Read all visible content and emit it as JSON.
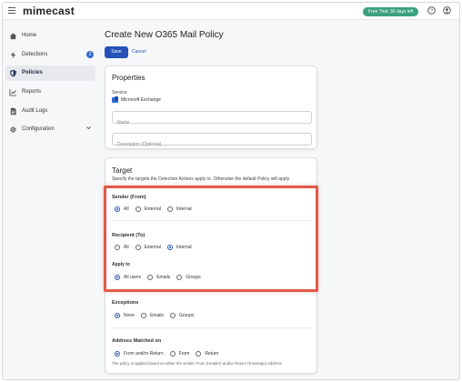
{
  "app": {
    "logo": "mimecast",
    "trial_badge": "Free Trial: 30 days left",
    "help_icon": "help-icon",
    "account_icon": "account-icon"
  },
  "sidebar": {
    "items": [
      {
        "label": "Home",
        "icon": "home-icon"
      },
      {
        "label": "Detections",
        "icon": "bolt-icon",
        "badge": "2"
      },
      {
        "label": "Policies",
        "icon": "shield-icon",
        "active": true
      },
      {
        "label": "Reports",
        "icon": "chart-icon"
      },
      {
        "label": "Audit Logs",
        "icon": "document-icon"
      },
      {
        "label": "Configuration",
        "icon": "gear-icon",
        "expandable": true
      }
    ]
  },
  "page": {
    "title": "Create New O365 Mail Policy",
    "save_label": "Save",
    "cancel_label": "Cancel"
  },
  "properties": {
    "title": "Properties",
    "service_label": "Service",
    "service_value": "Microsoft Exchange",
    "name_placeholder": "Name",
    "description_placeholder": "Description (Optional)"
  },
  "target": {
    "title": "Target",
    "description": "Specify the targets the Detection Actions apply to. Otherwise the default Policy will apply.",
    "sender": {
      "label": "Sender (From)",
      "options": [
        "All",
        "External",
        "Internal"
      ],
      "selected": "All"
    },
    "recipient": {
      "label": "Recipient (To)",
      "options": [
        "All",
        "External",
        "Internal"
      ],
      "selected": "Internal"
    },
    "apply_to": {
      "label": "Apply to",
      "options": [
        "All users",
        "Emails",
        "Groups"
      ],
      "selected": "All users"
    },
    "exceptions": {
      "label": "Exceptions",
      "options": [
        "None",
        "Emails",
        "Groups"
      ],
      "selected": "None"
    },
    "address_matched": {
      "label": "Address Matched on",
      "options": [
        "From and/or Return",
        "From",
        "Return"
      ],
      "selected": "From and/or Return",
      "note": "The policy is applied based on either the sender From (Header) and/or Return (Envelope) Address"
    }
  },
  "colors": {
    "primary": "#2652b8",
    "highlight": "#e05a4a",
    "trial": "#3aa17e"
  }
}
